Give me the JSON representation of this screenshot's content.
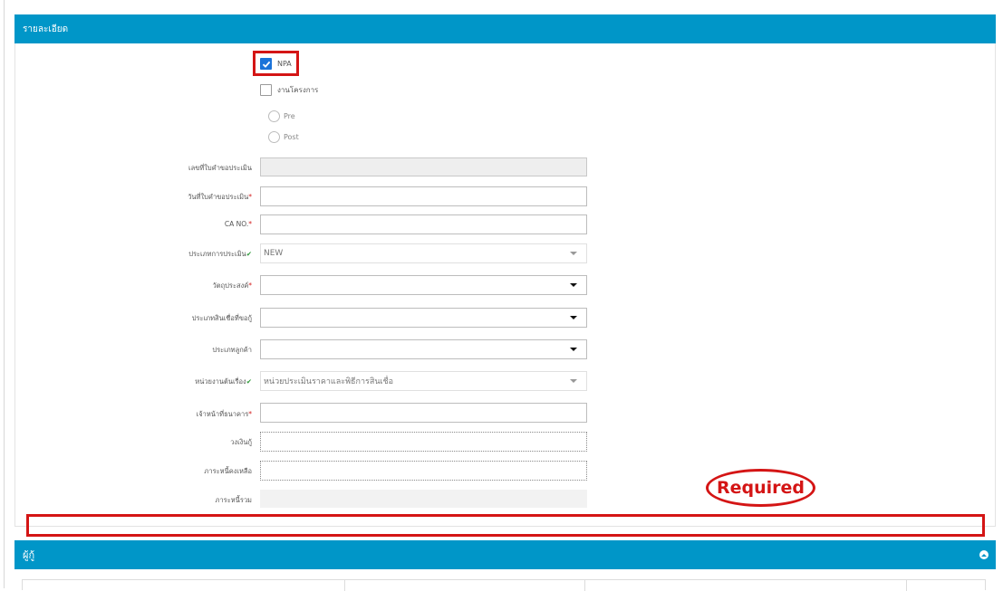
{
  "detail_panel": {
    "title": "รายละเอียด",
    "checkboxes": [
      {
        "label": "NPA",
        "checked": true
      },
      {
        "label": "งานโครงการ",
        "checked": false
      }
    ],
    "radios": [
      {
        "label": "Pre",
        "selected": false
      },
      {
        "label": "Post",
        "selected": false
      }
    ],
    "fields": {
      "request_no": {
        "label": "เลขที่ใบคำขอประเมิน",
        "value": ""
      },
      "request_date": {
        "label": "วันที่ใบคำขอประเมิน",
        "value": ""
      },
      "ca_no": {
        "label": "CA NO.",
        "value": ""
      },
      "appraisal_type": {
        "label": "ประเภทการประเมิน",
        "value": "NEW"
      },
      "objective": {
        "label": "วัตถุประสงค์",
        "value": ""
      },
      "credit_type": {
        "label": "ประเภทสินเชื่อที่ขอกู้",
        "value": ""
      },
      "customer_type": {
        "label": "ประเภทลูกค้า",
        "value": ""
      },
      "origin_unit": {
        "label": "หน่วยงานต้นเรื่อง",
        "value": "หน่วยประเมินราคาและพิธีการสินเชื่อ"
      },
      "bank_officer": {
        "label": "เจ้าหน้าที่ธนาคาร",
        "value": ""
      },
      "loan_limit": {
        "label": "วงเงินกู้",
        "value": ""
      },
      "remaining_debt": {
        "label": "ภาระหนี้คงเหลือ",
        "value": ""
      },
      "total_debt": {
        "label": "ภาระหนี้รวม",
        "value": ""
      }
    },
    "required_mark": "*",
    "annotation": "Required"
  },
  "bottom_panel": {
    "title": "ผู้กู้"
  },
  "colors": {
    "header_blue": "#0096c8",
    "annotation_red": "#d41515",
    "checkbox_blue": "#1a73d9",
    "valid_green": "#2e9a3a"
  }
}
